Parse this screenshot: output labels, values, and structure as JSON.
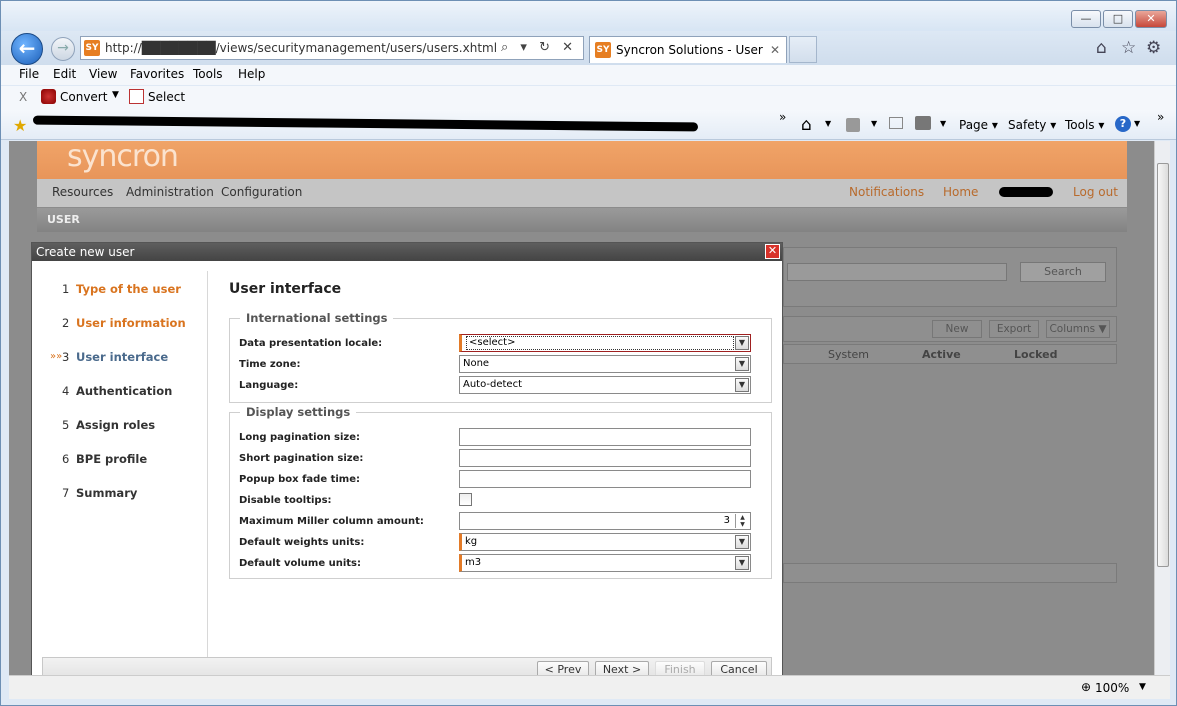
{
  "browser": {
    "address": "http://████████/views/securitymanagement/users/users.xhtml",
    "address_tools": "⌕ ▾ ↻ ✕",
    "tab_title": "Syncron Solutions - User",
    "tab_close": "✕",
    "favicon_text": "SY",
    "menu": [
      "File",
      "Edit",
      "View",
      "Favorites",
      "Tools",
      "Help"
    ],
    "cmd_close": "X",
    "convert_label": "Convert",
    "select_label": "Select",
    "toolbar": {
      "page": "Page",
      "safety": "Safety",
      "tools": "Tools"
    },
    "zoom": "100%",
    "chevrons": "»"
  },
  "app": {
    "logo": "syncron",
    "nav": [
      "Resources",
      "Administration",
      "Configuration"
    ],
    "notifications": "Notifications",
    "home": "Home",
    "logout": "Log out",
    "section": "USER",
    "search_button": "Search",
    "table_buttons": [
      "New",
      "Export",
      "Columns ▼"
    ],
    "table_headers": [
      "System",
      "Active",
      "Locked"
    ]
  },
  "dialog": {
    "title": "Create new user",
    "close": "✕",
    "steps": [
      {
        "num": "1",
        "label": "Type of the user",
        "state": "done"
      },
      {
        "num": "2",
        "label": "User information",
        "state": "done"
      },
      {
        "num": "3",
        "label": "User interface",
        "state": "current",
        "marker": "»»"
      },
      {
        "num": "4",
        "label": "Authentication",
        "state": "todo"
      },
      {
        "num": "5",
        "label": "Assign roles",
        "state": "todo"
      },
      {
        "num": "6",
        "label": "BPE profile",
        "state": "todo"
      },
      {
        "num": "7",
        "label": "Summary",
        "state": "todo"
      }
    ],
    "section_title": "User interface",
    "international": {
      "legend": "International settings",
      "locale_label": "Data presentation locale:",
      "locale_value": "<select>",
      "timezone_label": "Time zone:",
      "timezone_value": "None",
      "language_label": "Language:",
      "language_value": "Auto-detect"
    },
    "display": {
      "legend": "Display settings",
      "long_label": "Long pagination size:",
      "long_value": "",
      "short_label": "Short pagination size:",
      "short_value": "",
      "fade_label": "Popup box fade time:",
      "fade_value": "",
      "tooltips_label": "Disable tooltips:",
      "tooltips_checked": false,
      "miller_label": "Maximum Miller column amount:",
      "miller_value": "3",
      "weight_label": "Default weights units:",
      "weight_value": "kg",
      "volume_label": "Default volume units:",
      "volume_value": "m3"
    },
    "buttons": {
      "prev": "< Prev",
      "next": "Next >",
      "finish": "Finish",
      "cancel": "Cancel"
    }
  }
}
